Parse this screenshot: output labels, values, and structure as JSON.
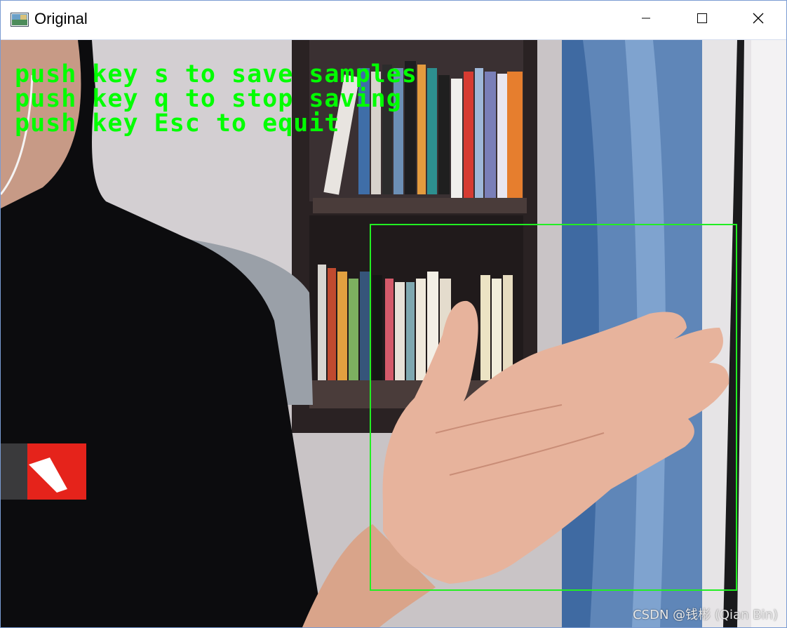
{
  "window": {
    "title": "Original",
    "icon": "image-window-icon",
    "controls": [
      "minimize-icon",
      "maximize-icon",
      "close-icon"
    ]
  },
  "overlay": {
    "lines": [
      "push key s to save samples",
      "push key q to stop saving",
      "push key Esc to equit"
    ],
    "text_color": "#00ff00",
    "box_color": "#22ee22"
  },
  "watermark": "CSDN @钱彬 (Qian Bin)"
}
